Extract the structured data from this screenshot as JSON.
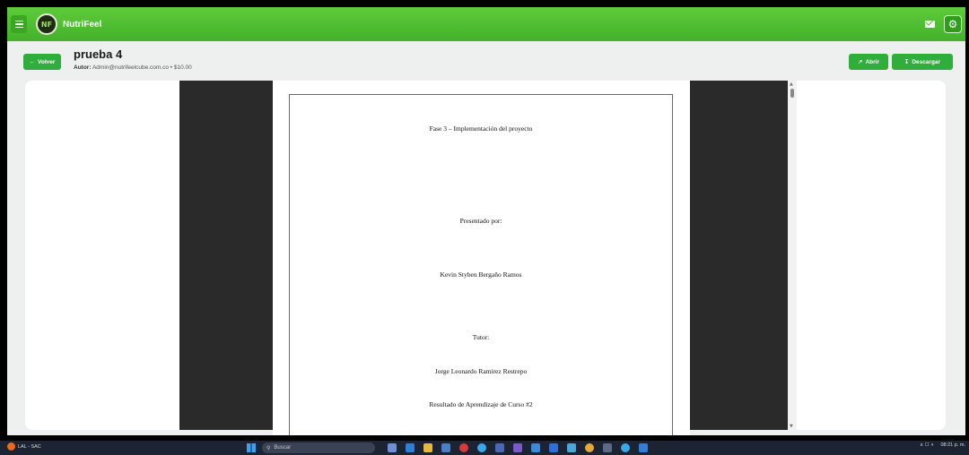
{
  "app": {
    "name": "NutriFeel",
    "logo_text": "NF"
  },
  "header": {
    "back_label": "Volver",
    "title": "prueba 4",
    "author_label": "Autor:",
    "author_value": "Admin@nutrifeelcube.com.co",
    "separator": "•",
    "price": "$10.00",
    "open_label": "Abrir",
    "download_label": "Descargar"
  },
  "document": {
    "lines": [
      "Fase 3 – Implementación del proyecto",
      "Presentado por:",
      "Kevin Styben Bergaño Ramos",
      "Tutor:",
      "Jorge Leonardo Ramírez Restrepo",
      "Resultado de Aprendizaje de Curso #2"
    ]
  },
  "taskbar": {
    "weather": "LAL - SAC",
    "search_placeholder": "Buscar",
    "time": "08:21 p. m.",
    "tray_text": "∧  ☐ ◑"
  },
  "colors": {
    "brand_green": "#43b22a",
    "button_green": "#2fae3c"
  }
}
